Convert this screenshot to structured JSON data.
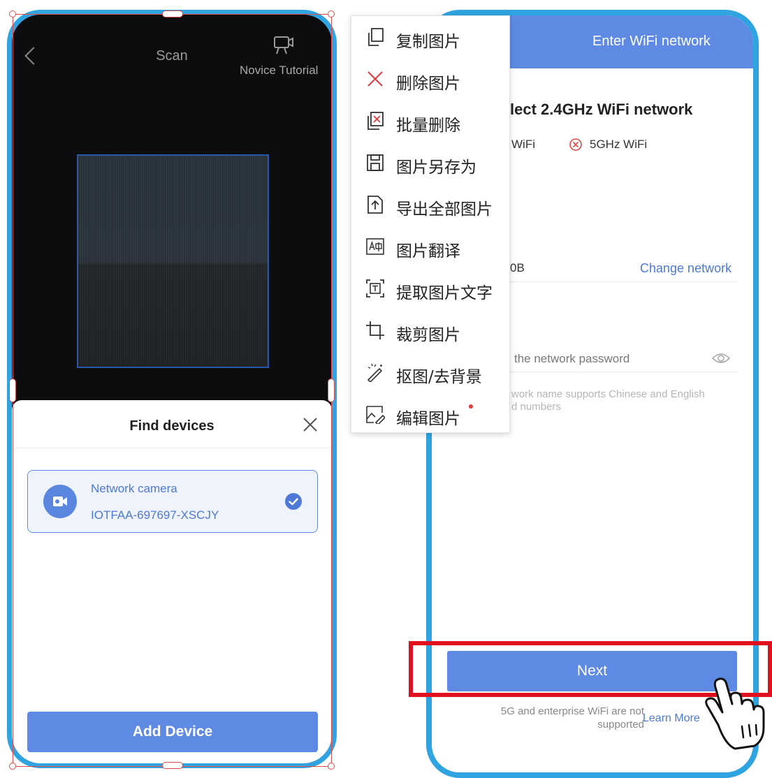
{
  "left_phone": {
    "scan_title": "Scan",
    "tutorial_label": "Novice Tutorial",
    "sheet_title": "Find devices",
    "device": {
      "name": "Network camera",
      "id": "IOTFAA-697697-XSCJY"
    },
    "add_button": "Add Device"
  },
  "context_menu": {
    "items": [
      {
        "label": "复制图片",
        "icon": "copy-icon"
      },
      {
        "label": "删除图片",
        "icon": "delete-icon"
      },
      {
        "label": "批量删除",
        "icon": "batch-delete-icon"
      },
      {
        "label": "图片另存为",
        "icon": "save-as-icon"
      },
      {
        "label": "导出全部图片",
        "icon": "export-icon"
      },
      {
        "label": "图片翻译",
        "icon": "translate-icon"
      },
      {
        "label": "提取图片文字",
        "icon": "extract-text-icon"
      },
      {
        "label": "裁剪图片",
        "icon": "crop-icon"
      },
      {
        "label": "抠图/去背景",
        "icon": "magic-wand-icon"
      },
      {
        "label": "编辑图片",
        "icon": "edit-image-icon"
      }
    ]
  },
  "right_phone": {
    "header_title": "Enter WiFi network",
    "section_title": "lect 2.4GHz WiFi network",
    "option_24": "WiFi",
    "option_5": "5GHz WiFi",
    "network_name": "0B",
    "change_network": "Change network",
    "password_placeholder": "the network password",
    "hint_line1": "work name supports Chinese and English",
    "hint_line2": "d numbers",
    "next_button": "Next",
    "footer_note_line1": "5G and enterprise WiFi are not",
    "footer_note_line2": "supported",
    "learn_more": "Learn More"
  },
  "colors": {
    "phone_frame": "#2fa4e1",
    "primary": "#5f8ae3",
    "highlight": "#e0101e",
    "selection": "#e34b4b"
  }
}
